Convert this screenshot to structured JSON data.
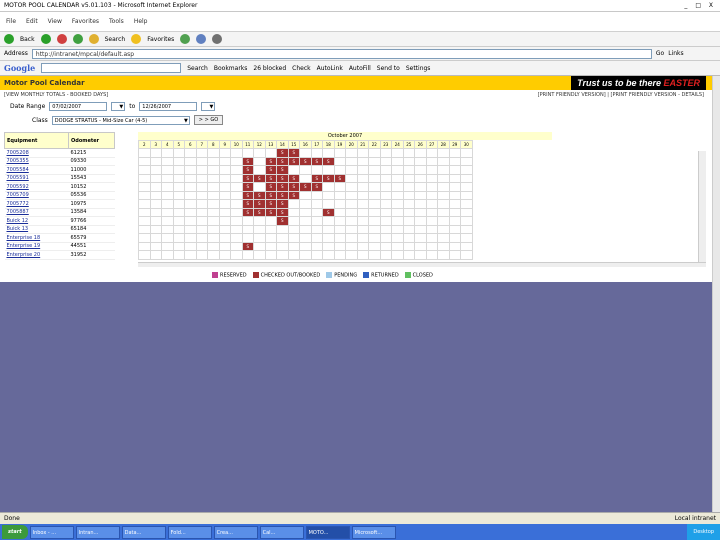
{
  "window": {
    "title": "MOTOR POOL CALENDAR v5.01.103 - Microsoft Internet Explorer",
    "controls": "_ □ X"
  },
  "menu": [
    "File",
    "Edit",
    "View",
    "Favorites",
    "Tools",
    "Help"
  ],
  "toolbar": {
    "back": "Back",
    "search": "Search",
    "favorites": "Favorites"
  },
  "address": {
    "label": "Address",
    "value": "http://intranet/mpcal/default.asp",
    "go": "Go",
    "links": "Links"
  },
  "google": {
    "logo": "Google",
    "search_label": "Search",
    "bookmarks": "Bookmarks",
    "blocked": "26 blocked",
    "check": "Check",
    "autolink": "AutoLink",
    "autofill": "AutoFill",
    "send_to": "Send to",
    "settings": "Settings"
  },
  "app": {
    "title": "Motor Pool Calendar",
    "tagline_prefix": "Trust us to be there",
    "tagline_brand": "EASTER",
    "view_info": "[VIEW MONTHLY TOTALS - BOOKED DAYS]",
    "links": "[PRINT FRIENDLY VERSION] | [PRINT FRIENDLY VERSION - DETAILS]",
    "date_range_label": "Date Range",
    "date_from": "07/02/2007",
    "date_to_label": "to",
    "date_to": "12/26/2007",
    "class_label": "Class",
    "class_value": "DODGE STRATUS - Mid-Size Car (4-5)",
    "go_button": "> > GO"
  },
  "equipment_table": {
    "headers": [
      "Equipment",
      "Odometer"
    ],
    "rows": [
      {
        "name": "7005208",
        "odo": "61215"
      },
      {
        "name": "7005355",
        "odo": "09330"
      },
      {
        "name": "7005584",
        "odo": "11000"
      },
      {
        "name": "7005591",
        "odo": "15543"
      },
      {
        "name": "7005592",
        "odo": "10152"
      },
      {
        "name": "7005709",
        "odo": "05536"
      },
      {
        "name": "7005772",
        "odo": "10975"
      },
      {
        "name": "7005887",
        "odo": "13584"
      },
      {
        "name": "Buick 12",
        "odo": "97766"
      },
      {
        "name": "Buick 13",
        "odo": "65184"
      },
      {
        "name": "Enterprise 18",
        "odo": "65579"
      },
      {
        "name": "Enterprise 19",
        "odo": "44551"
      },
      {
        "name": "Enterprise 20",
        "odo": "31952"
      }
    ]
  },
  "calendar": {
    "month": "October 2007",
    "days": [
      "2",
      "3",
      "4",
      "5",
      "6",
      "7",
      "8",
      "9",
      "10",
      "11",
      "12",
      "13",
      "14",
      "15",
      "16",
      "17",
      "18",
      "19",
      "20",
      "21",
      "22",
      "23",
      "24",
      "25",
      "26",
      "27",
      "28",
      "29",
      "30"
    ],
    "booked_mark": "S",
    "booked_colors": {
      "booked": "#a03030"
    },
    "rows": [
      [
        14,
        15
      ],
      [
        11,
        13,
        14,
        15,
        16,
        17,
        18
      ],
      [
        11,
        13,
        14
      ],
      [
        11,
        12,
        13,
        14,
        15,
        17,
        18,
        19
      ],
      [
        11,
        13,
        14,
        15,
        16,
        17
      ],
      [
        11,
        12,
        13,
        14,
        15
      ],
      [
        11,
        12,
        13,
        14
      ],
      [
        11,
        12,
        13,
        14,
        18
      ],
      [
        14
      ],
      [],
      [],
      [
        11
      ],
      []
    ]
  },
  "legend": [
    {
      "label": "RESERVED",
      "color": "#c04090"
    },
    {
      "label": "CHECKED OUT/BOOKED",
      "color": "#a03030"
    },
    {
      "label": "PENDING",
      "color": "#9fc9e8"
    },
    {
      "label": "RETURNED",
      "color": "#3060c0"
    },
    {
      "label": "CLOSED",
      "color": "#60c060"
    }
  ],
  "statusbar": {
    "left": "Done",
    "right": "Local intranet"
  },
  "taskbar": {
    "start": "start",
    "tasks": [
      "Inbox - ...",
      "Intran...",
      "Data...",
      "Fold...",
      "Crea...",
      "Cal...",
      "MOTO...",
      "Microsoft..."
    ],
    "active_index": 6,
    "tray": "Desktop"
  }
}
